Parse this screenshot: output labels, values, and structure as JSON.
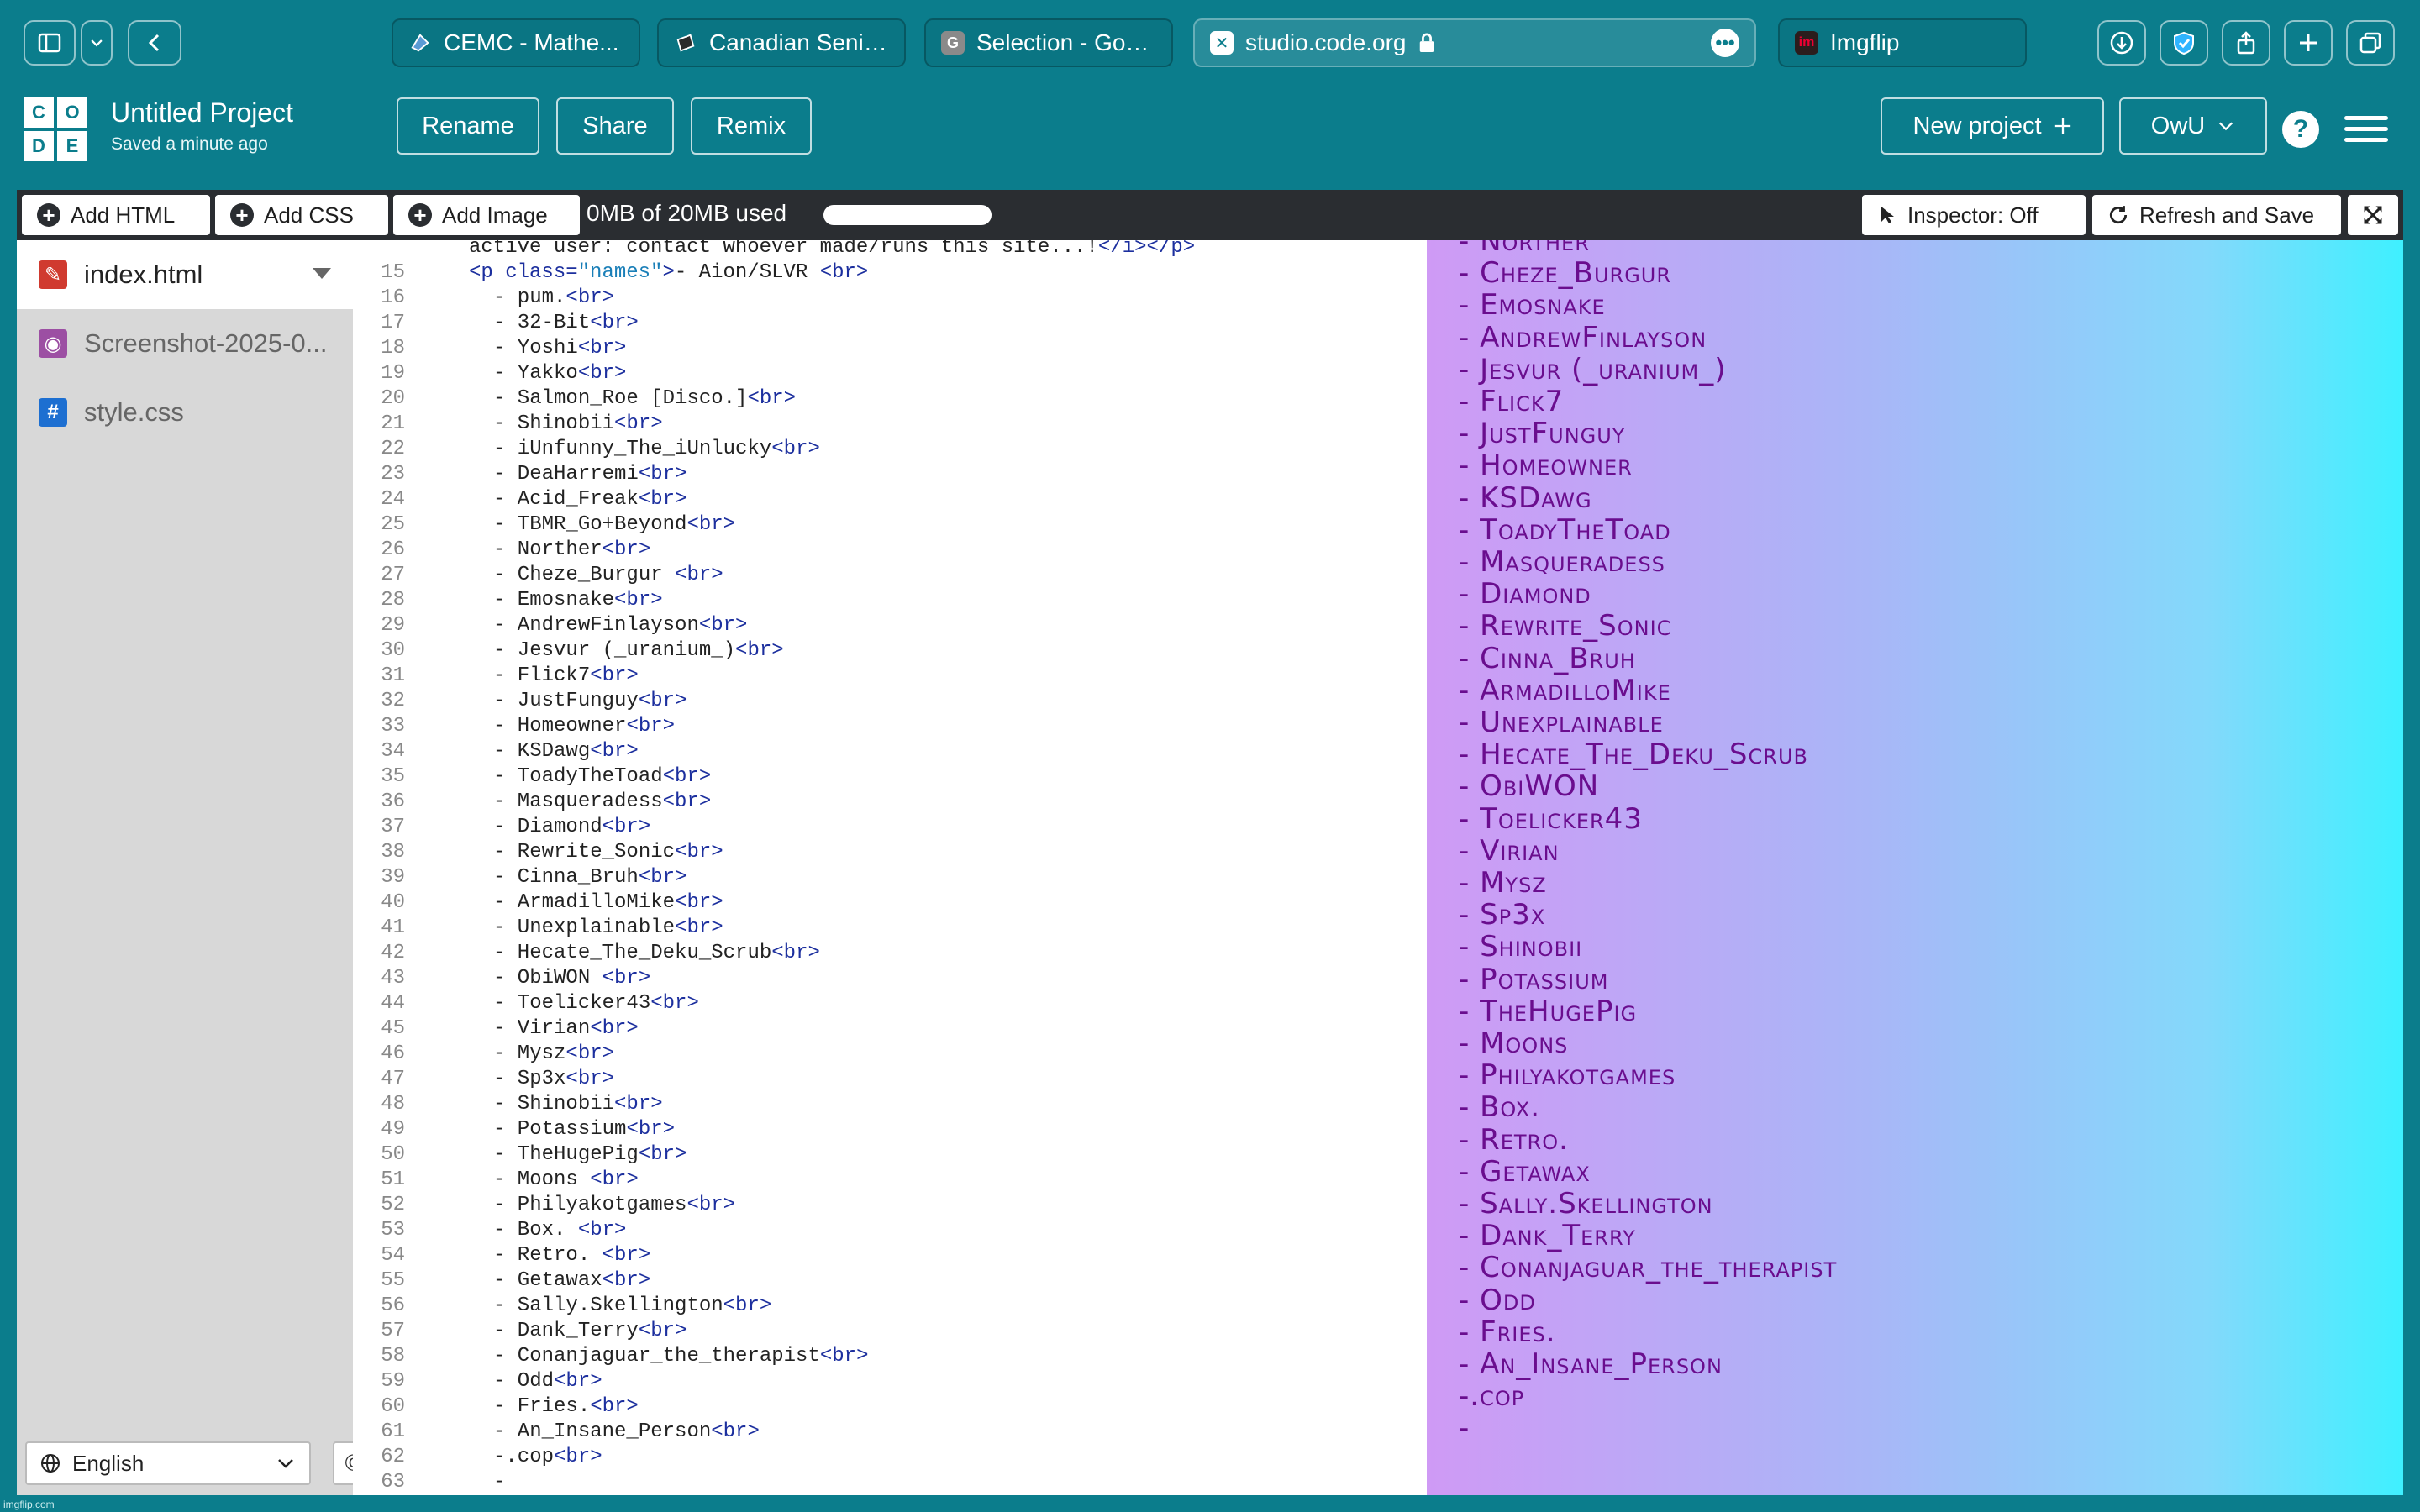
{
  "browser": {
    "tabs": [
      {
        "label": "CEMC - Mathe...",
        "icon": "cemc-icon"
      },
      {
        "label": "Canadian Senior...",
        "icon": "cemc-icon"
      },
      {
        "label": "Selection - Goo...",
        "icon": "google-icon",
        "icon_text": "G"
      },
      {
        "label": "studio.code.org",
        "icon": "code-org-icon"
      },
      {
        "label": "Imgflip",
        "icon": "imgflip-icon",
        "icon_text": "im"
      }
    ]
  },
  "header": {
    "logo": [
      "C",
      "O",
      "D",
      "E"
    ],
    "project_name": "Untitled Project",
    "saved_status": "Saved a minute ago",
    "rename_label": "Rename",
    "share_label": "Share",
    "remix_label": "Remix",
    "new_project_label": "New project",
    "user_label": "OwU",
    "help_label": "?"
  },
  "toolbar": {
    "add_html_label": "Add HTML",
    "add_css_label": "Add CSS",
    "add_image_label": "Add Image",
    "storage_text": "0MB of 20MB used",
    "storage_used_fraction": 0.0,
    "inspector_label": "Inspector: Off",
    "refresh_label": "Refresh and Save"
  },
  "files": [
    {
      "name": "index.html",
      "type": "html"
    },
    {
      "name": "Screenshot-2025-0...",
      "type": "image"
    },
    {
      "name": "style.css",
      "type": "css"
    }
  ],
  "language_label": "English",
  "copyright_label": "©",
  "code": {
    "partial_line": "active user: contact whoever made/runs this site...!</i></p>",
    "first_line_number": 15,
    "p_open": "<p class=\"names\">",
    "p_rest": "- Aion/SLVR <br>",
    "names": [
      "pum.",
      "32-Bit",
      "Yoshi",
      "Yakko",
      "Salmon_Roe [Disco.]",
      "Shinobii",
      "iUnfunny_The_iUnlucky",
      "DeaHarremi",
      "Acid_Freak",
      "TBMR_Go+Beyond",
      "Norther",
      "Cheze_Burgur ",
      "Emosnake",
      "AndrewFinlayson",
      "Jesvur (_uranium_)",
      "Flick7",
      "JustFunguy",
      "Homeowner",
      "KSDawg",
      "ToadyTheToad",
      "Masqueradess",
      "Diamond",
      "Rewrite_Sonic",
      "Cinna_Bruh",
      "ArmadilloMike",
      "Unexplainable",
      "Hecate_The_Deku_Scrub",
      "ObiWON ",
      "Toelicker43",
      "Virian",
      "Mysz",
      "Sp3x",
      "Shinobii",
      "Potassium",
      "TheHugePig",
      "Moons ",
      "Philyakotgames",
      "Box. ",
      "Retro. ",
      "Getawax",
      "Sally.Skellington",
      "Dank_Terry",
      "Conanjaguar_the_therapist",
      "Odd",
      "Fries.",
      "An_Insane_Person"
    ],
    "cop_line": "-.cop<br>",
    "last_line": "- "
  },
  "preview": {
    "lines": [
      "- Norther",
      "- Cheze_Burgur",
      "- Emosnake",
      "- AndrewFinlayson",
      "- Jesvur (_uranium_)",
      "- Flick7",
      "- JustFunguy",
      "- Homeowner",
      "- KSDawg",
      "- ToadyTheToad",
      "- Masqueradess",
      "- Diamond",
      "- Rewrite_Sonic",
      "- Cinna_Bruh",
      "- ArmadilloMike",
      "- Unexplainable",
      "- Hecate_The_Deku_Scrub",
      "- ObiWON",
      "- Toelicker43",
      "- Virian",
      "- Mysz",
      "- Sp3x",
      "- Shinobii",
      "- Potassium",
      "- TheHugePig",
      "- Moons",
      "- Philyakotgames",
      "- Box.",
      "- Retro.",
      "- Getawax",
      "- Sally.Skellington",
      "- Dank_Terry",
      "- Conanjaguar_the_therapist",
      "- Odd",
      "- Fries.",
      "- An_Insane_Person",
      "-.cop",
      "-"
    ]
  },
  "footer_credit": "imgflip.com",
  "colors": {
    "chrome": "#0b7d8c",
    "toolbar": "#2a2d31",
    "preview_text": "#6a0d8e",
    "html_tag": "#1c2f9e",
    "attr_value": "#1a7fb8"
  }
}
